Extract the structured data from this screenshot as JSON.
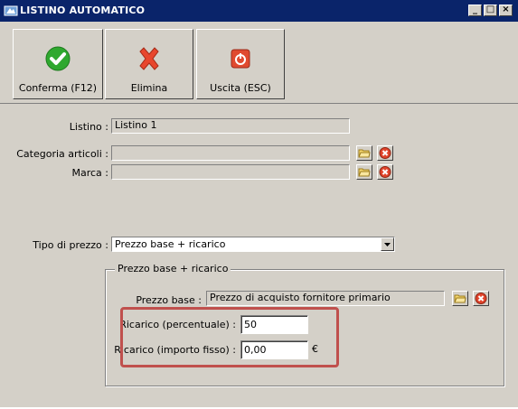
{
  "window": {
    "title": "LISTINO AUTOMATICO",
    "minimize": "_",
    "maximize": "□",
    "close": "×"
  },
  "toolbar": {
    "confirm_label": "Conferma (F12)",
    "delete_label": "Elimina",
    "exit_label": "Uscita (ESC)"
  },
  "form": {
    "listino_label": "Listino :",
    "listino_value": "Listino 1",
    "categoria_label": "Categoria articoli :",
    "categoria_value": "",
    "marca_label": "Marca :",
    "marca_value": "",
    "tipo_prezzo_label": "Tipo di prezzo :",
    "tipo_prezzo_value": "Prezzo base + ricarico"
  },
  "group": {
    "title": "Prezzo base + ricarico",
    "prezzo_base_label": "Prezzo base :",
    "prezzo_base_value": "Prezzo di acquisto fornitore primario",
    "ricarico_perc_label": "Ricarico (percentuale) :",
    "ricarico_perc_value": "50",
    "ricarico_fisso_label": "Ricarico (importo fisso) :",
    "ricarico_fisso_value": "0,00",
    "currency": "€"
  },
  "colors": {
    "titlebar": "#0a246a",
    "window_bg": "#d4d0c8",
    "highlight": "#c0504d"
  },
  "icons": [
    "app-icon",
    "check-icon",
    "cross-icon",
    "exit-icon",
    "folder-icon",
    "delete-icon",
    "dropdown-arrow-icon"
  ]
}
